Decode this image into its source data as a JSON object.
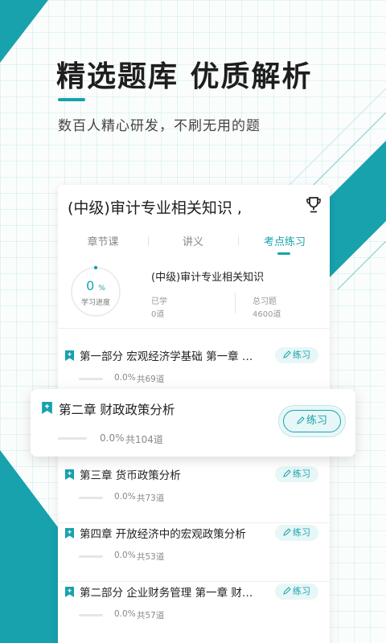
{
  "hero": {
    "headline": "精选题库  优质解析",
    "subheadline": "数百人精心研发，不刷无用的题"
  },
  "course": {
    "title": "(中级)审计专业相关知识 ,",
    "tabs": [
      {
        "label": "章节课",
        "active": false
      },
      {
        "label": "讲义",
        "active": false
      },
      {
        "label": "考点练习",
        "active": true
      }
    ],
    "progress": {
      "percent": "0",
      "percent_unit": "%",
      "label": "学习进度",
      "title": "(中级)审计专业相关知识",
      "learned_label": "已学",
      "learned_value": "0道",
      "total_label": "总习题",
      "total_value": "4600道"
    }
  },
  "chapters": [
    {
      "title": "第一部分 宏观经济学基础 第一章 概...",
      "percent": "0.0%",
      "total": "共69道",
      "button": "练习"
    },
    {
      "title": "第二章 财政政策分析",
      "percent": "0.0%",
      "total": "共104道",
      "button": "练习",
      "highlighted": true
    },
    {
      "title": "第三章 货币政策分析",
      "percent": "0.0%",
      "total": "共73道",
      "button": "练习"
    },
    {
      "title": "第四章 开放经济中的宏观政策分析",
      "percent": "0.0%",
      "total": "共53道",
      "button": "练习"
    },
    {
      "title": "第二部分 企业财务管理 第一章 财务...",
      "percent": "0.0%",
      "total": "共57道",
      "button": "练习"
    }
  ],
  "colors": {
    "accent": "#17a2ad",
    "accent_light": "#e7f6f6",
    "bookmark": "#17a2ad"
  },
  "icons": {
    "trophy": "trophy-icon",
    "bookmark": "bookmark-icon",
    "practice": "pen-icon"
  }
}
